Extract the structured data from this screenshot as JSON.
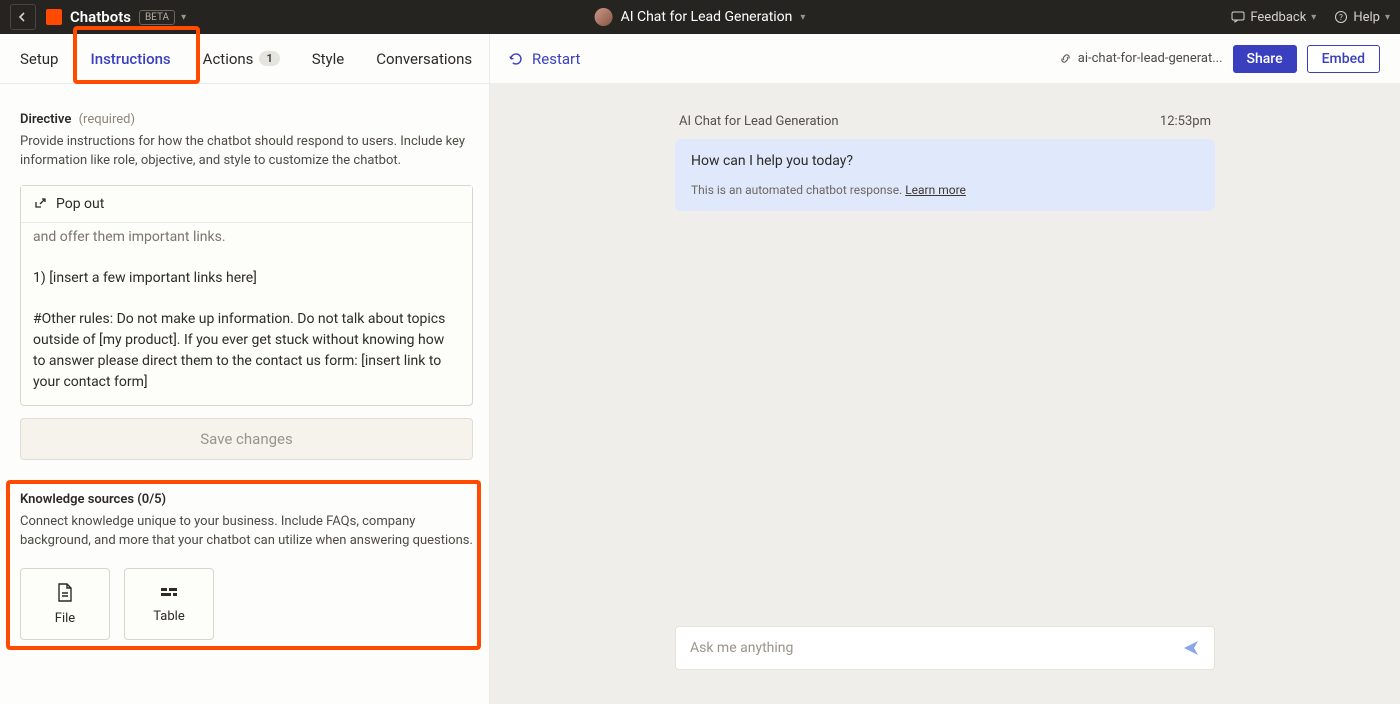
{
  "header": {
    "app_name": "Chatbots",
    "beta_label": "BETA",
    "project_name": "AI Chat for Lead Generation",
    "feedback_label": "Feedback",
    "help_label": "Help"
  },
  "tabs": {
    "setup": "Setup",
    "instructions": "Instructions",
    "actions": "Actions",
    "actions_count": "1",
    "style": "Style",
    "conversations": "Conversations"
  },
  "right_top": {
    "restart_label": "Restart",
    "url_slug": "ai-chat-for-lead-generat...",
    "share_label": "Share",
    "embed_label": "Embed"
  },
  "directive": {
    "label": "Directive",
    "required_text": "(required)",
    "help": "Provide instructions for how the chatbot should respond to users. Include key information like role, objective, and style to customize the chatbot.",
    "popout_label": "Pop out",
    "line_cutoff": "and offer them important links.",
    "line_links": "1) [insert a few important links here]",
    "line_rules": "#Other rules: Do not make up information. Do not talk about topics outside of [my product]. If you ever get stuck without knowing how to answer please direct them to the contact us form: [insert link to your contact form]",
    "save_label": "Save changes"
  },
  "knowledge": {
    "label": "Knowledge sources (0/5)",
    "help": "Connect knowledge unique to your business. Include FAQs, company background, and more that your chatbot can utilize when answering questions.",
    "file_label": "File",
    "table_label": "Table"
  },
  "chat": {
    "title": "AI Chat for Lead Generation",
    "timestamp": "12:53pm",
    "greeting": "How can I help you today?",
    "note_prefix": "This is an automated chatbot response. ",
    "learn_more": "Learn more",
    "input_placeholder": "Ask me anything"
  }
}
